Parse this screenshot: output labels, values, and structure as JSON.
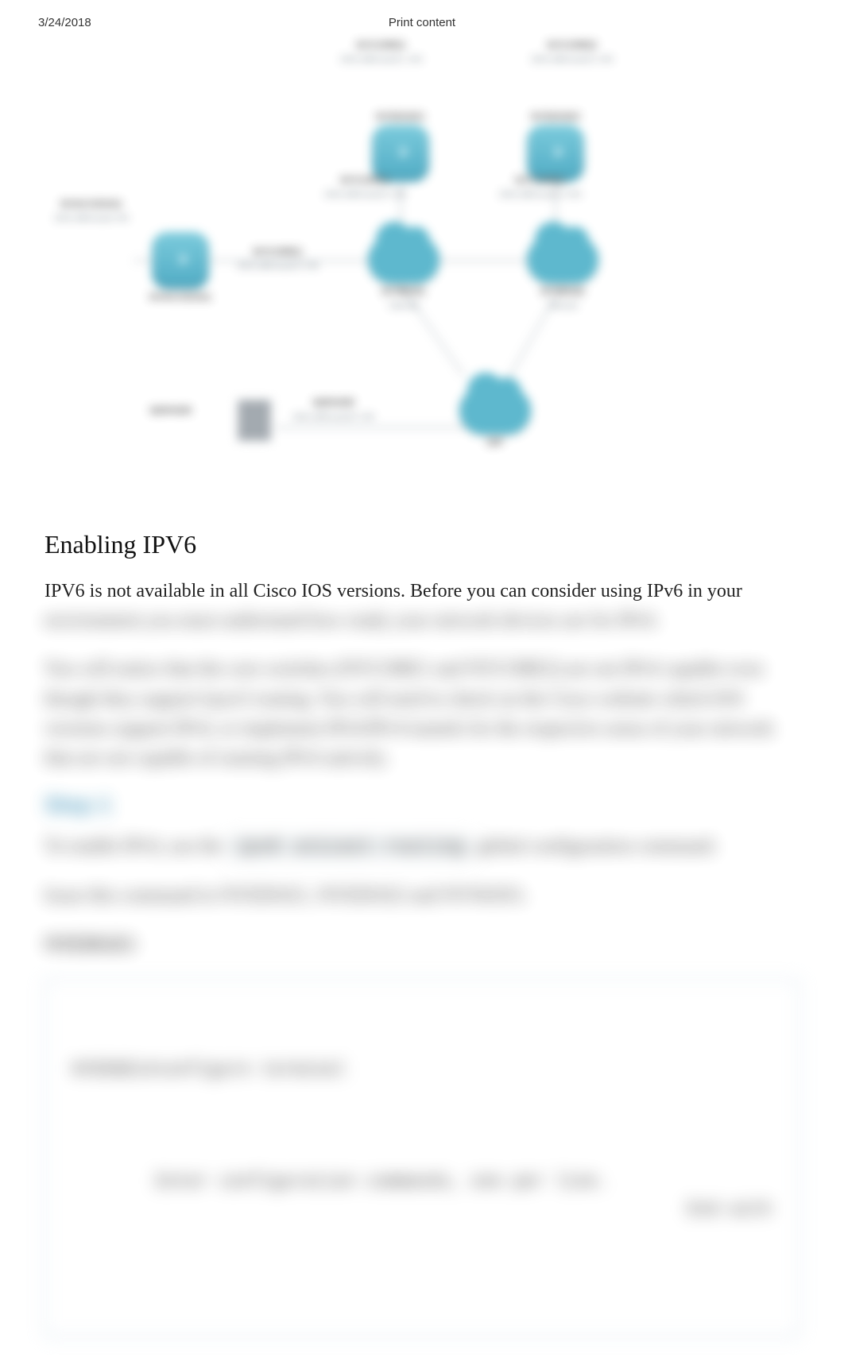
{
  "header": {
    "date": "3/24/2018",
    "title": "Print content"
  },
  "diagram": {
    "nodes": {
      "sw_top_left": {
        "name": "NYCORE1",
        "addr": "2001:db8:acad:1::/64"
      },
      "sw_top_right": {
        "name": "NYCORE2",
        "addr": "2001:db8:acad:2::/64"
      },
      "rtr_left": {
        "name": "NYEDGE1"
      },
      "rtr_right": {
        "name": "NYEDGE2"
      },
      "sw_mid_left": {
        "name": "NYCORE1",
        "addr": "2001:db8:acad:3::/64"
      },
      "sw_mid_right": {
        "name": "NYCORE2",
        "addr": "2001:db8:acad:4::/64"
      },
      "sw_far_left": {
        "name": "NYACCESS1",
        "addr": "2001:db8:acad::/64"
      },
      "access_rtr": {
        "name": "NYACCESS1"
      },
      "wan_left": {
        "name": "NYWAN1",
        "caption": "Internet"
      },
      "wan_right": {
        "name": "NYWAN2",
        "caption": "Internet"
      },
      "server": {
        "name": "SERVER",
        "addr": "2001:db8:acad:5::/64"
      },
      "isp": {
        "name": "ISP"
      }
    }
  },
  "section": {
    "heading": "Enabling IPV6",
    "p1_a": "IPV6 is not available in all Cisco IOS versions. Before you can consider using IPv6 in your ",
    "p1_b": "environment you must understand how ready your network devices are for IPv6.",
    "p2": "You will notice that the core switches (NYCORE1 and NYCORE2) are not IPv6 capable even though they support layer3 routing. You will need to check on the Cisco website which IOS versions support IPv6, or implement IPv6/IPv4 tunnels for the respective areas of your network that are not capable of running IPv6 natively."
  },
  "step": {
    "title": "Step 1",
    "line1_a": "To enable IPv6, use the ",
    "line1_cmd": "ipv6 unicast-routing",
    "line1_b": " global configuration command.",
    "line2": "Issue this command in NYEDGE1, NYEDGE2 and NYWAN1.",
    "device": "NYEDGE1"
  },
  "terminal": {
    "l1": "NYEDGE1#configure terminal",
    "l2_a": "Enter configuration commands, one per line.",
    "l2_b": "End with"
  }
}
